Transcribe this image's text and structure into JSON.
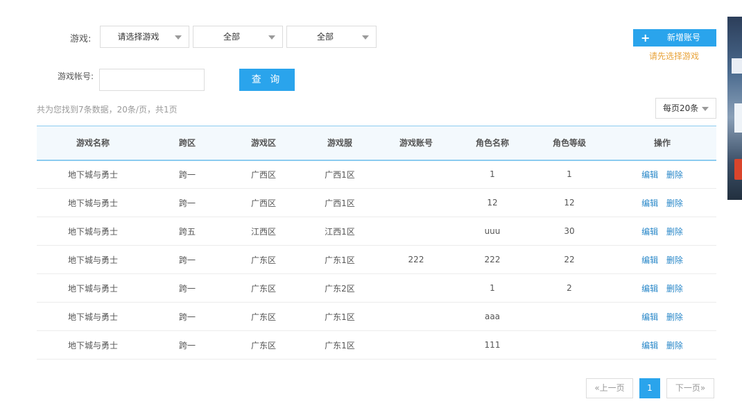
{
  "filters": {
    "game_label": "游戏:",
    "game_select": "请选择游戏",
    "region_select": "全部",
    "server_select": "全部",
    "account_label": "游戏帐号:",
    "account_value": "",
    "query_button": "查 询"
  },
  "actions": {
    "add_button": "新增账号",
    "add_icon": "+",
    "hint": "请先选择游戏"
  },
  "summary": "共为您找到7条数据，20条/页，共1页",
  "page_size": "每页20条",
  "table": {
    "headers": [
      "游戏名称",
      "跨区",
      "游戏区",
      "游戏服",
      "游戏账号",
      "角色名称",
      "角色等级",
      "操作"
    ],
    "rows": [
      [
        "地下城与勇士",
        "跨一",
        "广西区",
        "广西1区",
        "",
        "1",
        "1"
      ],
      [
        "地下城与勇士",
        "跨一",
        "广西区",
        "广西1区",
        "",
        "12",
        "12"
      ],
      [
        "地下城与勇士",
        "跨五",
        "江西区",
        "江西1区",
        "",
        "uuu",
        "30"
      ],
      [
        "地下城与勇士",
        "跨一",
        "广东区",
        "广东1区",
        "222",
        "222",
        "22"
      ],
      [
        "地下城与勇士",
        "跨一",
        "广东区",
        "广东2区",
        "",
        "1",
        "2"
      ],
      [
        "地下城与勇士",
        "跨一",
        "广东区",
        "广东1区",
        "",
        "aaa",
        ""
      ],
      [
        "地下城与勇士",
        "跨一",
        "广东区",
        "广东1区",
        "",
        "111",
        ""
      ]
    ],
    "edit_label": "编辑",
    "delete_label": "删除"
  },
  "pagination": {
    "prev": "«上一页",
    "current": "1",
    "next": "下一页»"
  },
  "colors": {
    "accent": "#2aa4ec",
    "link": "#2a88c9",
    "hint": "#e8a33a",
    "header_bg": "#f3f9fd"
  }
}
